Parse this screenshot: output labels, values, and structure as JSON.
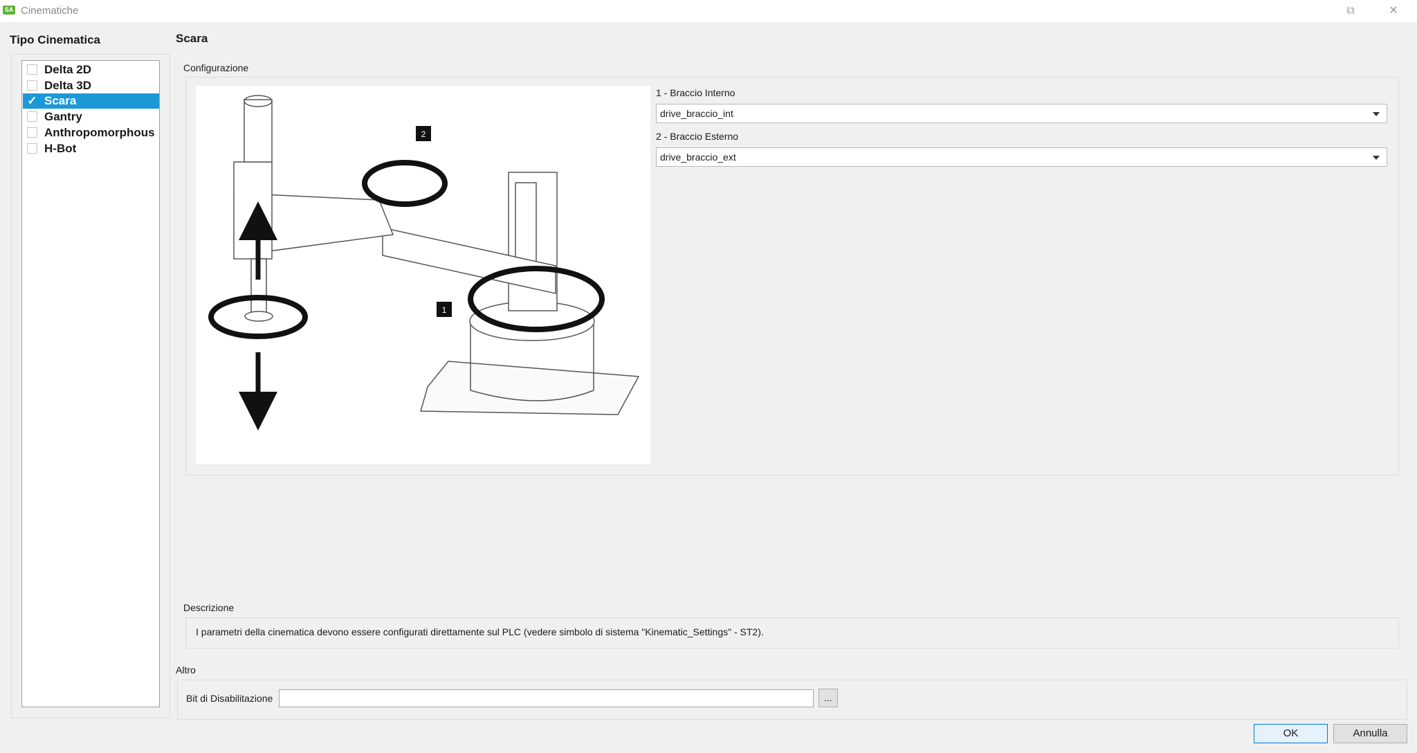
{
  "window": {
    "icon_text": "SA",
    "title": "Cinematiche",
    "maximize_glyph": "⧉",
    "close_glyph": "✕"
  },
  "left": {
    "heading": "Tipo Cinematica",
    "items": [
      {
        "label": "Delta 2D",
        "checked": false
      },
      {
        "label": "Delta 3D",
        "checked": false
      },
      {
        "label": "Scara",
        "checked": true,
        "check_glyph": "✓"
      },
      {
        "label": "Gantry",
        "checked": false
      },
      {
        "label": "Anthropomorphous",
        "checked": false
      },
      {
        "label": "H-Bot",
        "checked": false
      }
    ]
  },
  "main": {
    "heading": "Scara",
    "config": {
      "label": "Configurazione",
      "diagram_badges": [
        "2",
        "1"
      ],
      "field1": {
        "label": "1 - Braccio Interno",
        "value": "drive_braccio_int"
      },
      "field2": {
        "label": "2 - Braccio Esterno",
        "value": "drive_braccio_ext"
      }
    },
    "description": {
      "label": "Descrizione",
      "text": "I parametri della cinematica devono essere configurati direttamente sul PLC (vedere simbolo di sistema \"Kinematic_Settings\" - ST2)."
    },
    "altro": {
      "label": "Altro",
      "bit_label": "Bit di Disabilitazione",
      "bit_value": "",
      "browse_label": "..."
    }
  },
  "footer": {
    "ok_label": "OK",
    "cancel_label": "Annulla"
  },
  "colors": {
    "selection": "#1c98d6",
    "app_icon": "#5fb234",
    "ok_border": "#0078d7"
  }
}
